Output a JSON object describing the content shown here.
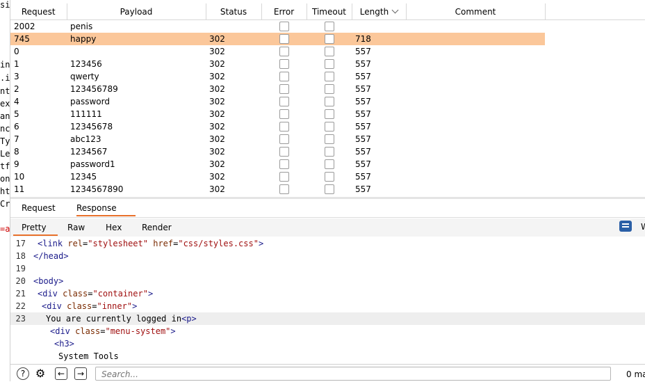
{
  "left_panel_fragments": [
    "sit",
    "in",
    ".i",
    "nt",
    "ex",
    "an",
    "nc",
    "Ty",
    "Le",
    "tf",
    "on",
    "ht",
    "Cr",
    "=a"
  ],
  "results_table": {
    "columns": [
      "Request",
      "Payload",
      "Status",
      "Error",
      "Timeout",
      "Length",
      "Comment"
    ],
    "sorted_column": "Length",
    "rows": [
      {
        "request": "2002",
        "payload": "penis",
        "status": "",
        "length": "",
        "selected": false
      },
      {
        "request": "745",
        "payload": "happy",
        "status": "302",
        "length": "718",
        "selected": true
      },
      {
        "request": "0",
        "payload": "",
        "status": "302",
        "length": "557",
        "selected": false
      },
      {
        "request": "1",
        "payload": "123456",
        "status": "302",
        "length": "557",
        "selected": false
      },
      {
        "request": "3",
        "payload": "qwerty",
        "status": "302",
        "length": "557",
        "selected": false
      },
      {
        "request": "2",
        "payload": "123456789",
        "status": "302",
        "length": "557",
        "selected": false
      },
      {
        "request": "4",
        "payload": "password",
        "status": "302",
        "length": "557",
        "selected": false
      },
      {
        "request": "5",
        "payload": "111111",
        "status": "302",
        "length": "557",
        "selected": false
      },
      {
        "request": "6",
        "payload": "12345678",
        "status": "302",
        "length": "557",
        "selected": false
      },
      {
        "request": "7",
        "payload": "abc123",
        "status": "302",
        "length": "557",
        "selected": false
      },
      {
        "request": "8",
        "payload": "1234567",
        "status": "302",
        "length": "557",
        "selected": false
      },
      {
        "request": "9",
        "payload": "password1",
        "status": "302",
        "length": "557",
        "selected": false
      },
      {
        "request": "10",
        "payload": "12345",
        "status": "302",
        "length": "557",
        "selected": false
      },
      {
        "request": "11",
        "payload": "1234567890",
        "status": "302",
        "length": "557",
        "selected": false
      }
    ]
  },
  "message_tabs": {
    "request": "Request",
    "response": "Response",
    "active": "Response"
  },
  "view_tabs": {
    "pretty": "Pretty",
    "raw": "Raw",
    "hex": "Hex",
    "render": "Render",
    "active": "Pretty"
  },
  "format_icon": "format-lines-icon",
  "format_label_cut": "W",
  "code_lines": [
    {
      "num": "17",
      "indent": 1,
      "tokens": [
        [
          "tag",
          "<link "
        ],
        [
          "attr",
          "rel"
        ],
        [
          "txt",
          "="
        ],
        [
          "str",
          "\"stylesheet\""
        ],
        [
          "txt",
          " "
        ],
        [
          "attr",
          "href"
        ],
        [
          "txt",
          "="
        ],
        [
          "str",
          "\"css/styles.css\""
        ],
        [
          "tag",
          ">"
        ]
      ]
    },
    {
      "num": "18",
      "indent": 0,
      "tokens": [
        [
          "tag",
          "</head>"
        ]
      ]
    },
    {
      "num": "19",
      "indent": 0,
      "tokens": []
    },
    {
      "num": "20",
      "indent": 0,
      "tokens": [
        [
          "tag",
          "<body>"
        ]
      ]
    },
    {
      "num": "21",
      "indent": 1,
      "tokens": [
        [
          "tag",
          "<div "
        ],
        [
          "attr",
          "class"
        ],
        [
          "txt",
          "="
        ],
        [
          "str",
          "\"container\""
        ],
        [
          "tag",
          ">"
        ]
      ]
    },
    {
      "num": "22",
      "indent": 2,
      "tokens": [
        [
          "tag",
          "<div "
        ],
        [
          "attr",
          "class"
        ],
        [
          "txt",
          "="
        ],
        [
          "str",
          "\"inner\""
        ],
        [
          "tag",
          ">"
        ]
      ]
    },
    {
      "num": "23",
      "indent": 3,
      "highlighted": true,
      "tokens": [
        [
          "txt",
          "You are currently logged in"
        ],
        [
          "tag",
          "<p>"
        ]
      ]
    },
    {
      "num": "",
      "indent": 4,
      "tokens": [
        [
          "tag",
          "<div "
        ],
        [
          "attr",
          "class"
        ],
        [
          "txt",
          "="
        ],
        [
          "str",
          "\"menu-system\""
        ],
        [
          "tag",
          ">"
        ]
      ]
    },
    {
      "num": "",
      "indent": 5,
      "tokens": [
        [
          "tag",
          "<h3>"
        ]
      ]
    },
    {
      "num": "",
      "indent": 6,
      "tokens": [
        [
          "txt",
          "System Tools"
        ]
      ]
    }
  ],
  "bottom_bar": {
    "search_placeholder": "Search...",
    "matches_text": "0 ma",
    "icons": [
      "help-icon",
      "settings-icon",
      "back-icon",
      "forward-icon"
    ]
  }
}
